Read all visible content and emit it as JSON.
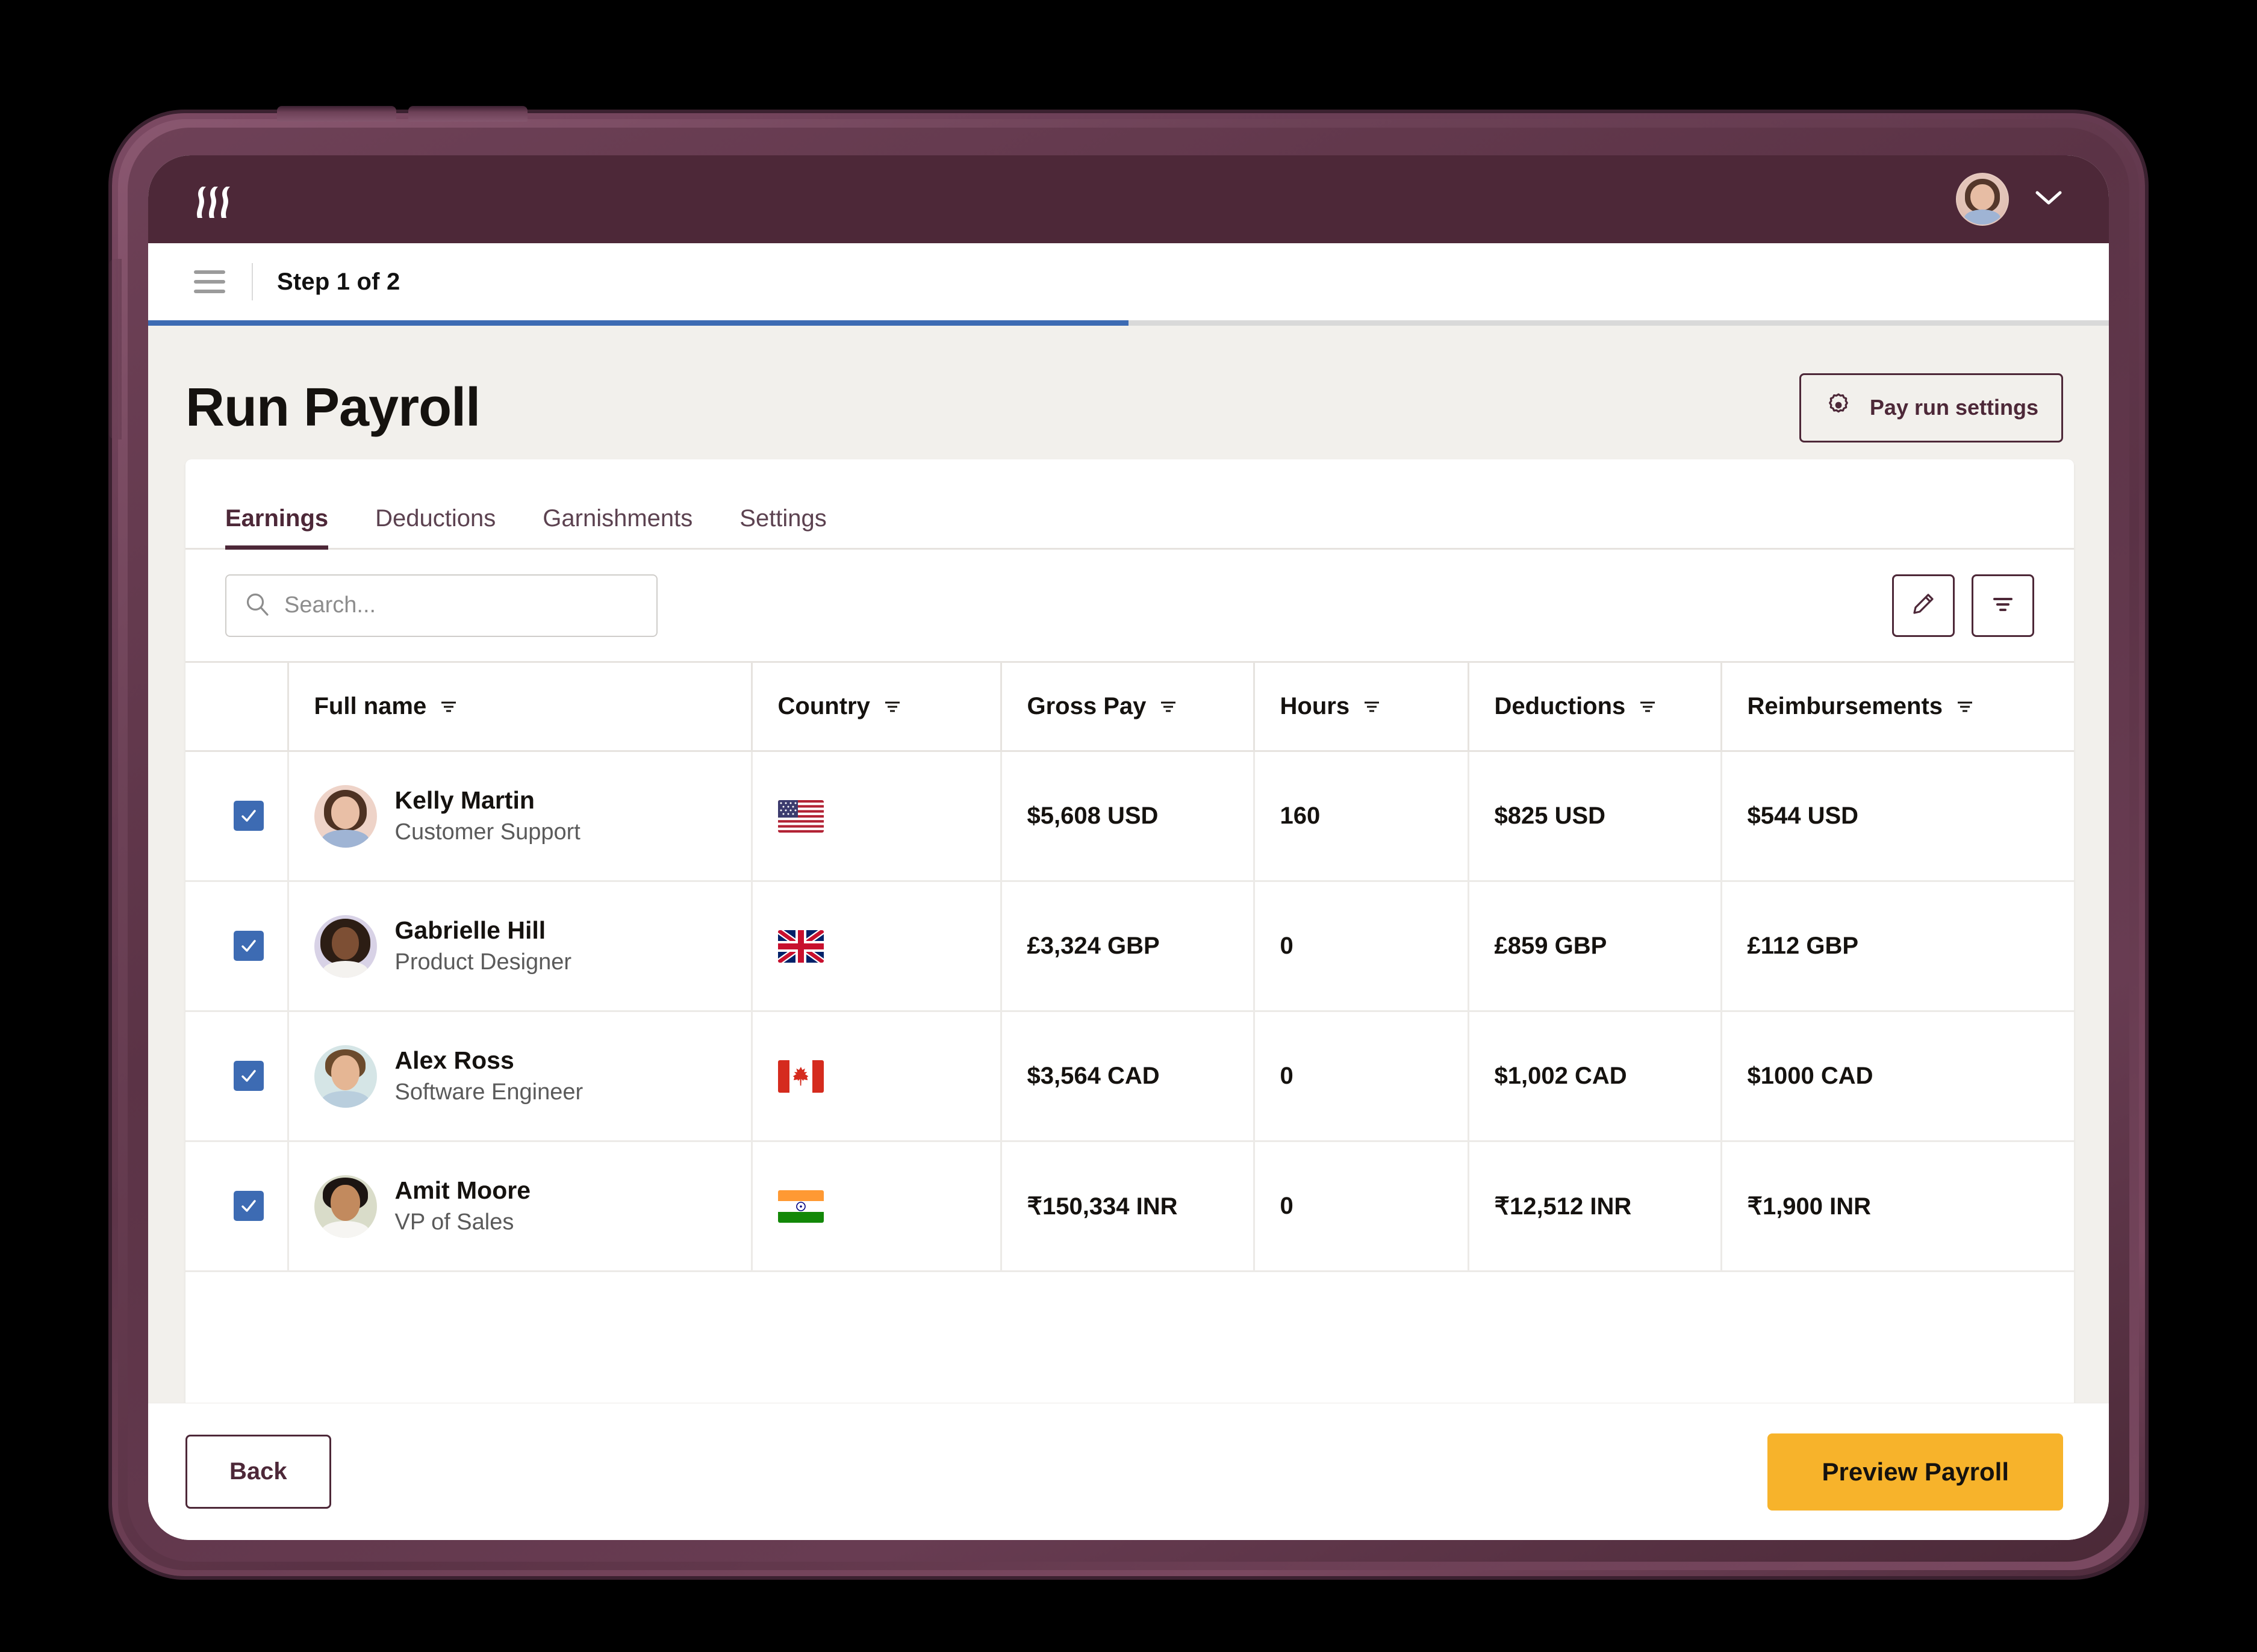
{
  "appbar": {
    "logo_name": "remote-logo",
    "avatar_name": "user-avatar",
    "chevron": "chevron-down-icon"
  },
  "stepbar": {
    "menu_icon": "hamburger-menu-icon",
    "step_label": "Step 1 of 2",
    "progress_percent": 50
  },
  "header": {
    "title": "Run Payroll",
    "settings_button": "Pay run settings",
    "settings_icon": "gear-icon"
  },
  "tabs": [
    {
      "label": "Earnings",
      "active": true
    },
    {
      "label": "Deductions",
      "active": false
    },
    {
      "label": "Garnishments",
      "active": false
    },
    {
      "label": "Settings",
      "active": false
    }
  ],
  "toolbar": {
    "search_placeholder": "Search...",
    "search_value": "",
    "search_icon": "search-icon",
    "edit_icon": "pencil-icon",
    "filter_icon": "filter-icon"
  },
  "table": {
    "columns": [
      {
        "key": "name",
        "label": "Full name",
        "sort_icon": "sort-icon"
      },
      {
        "key": "country",
        "label": "Country",
        "sort_icon": "sort-icon"
      },
      {
        "key": "gross",
        "label": "Gross Pay",
        "sort_icon": "sort-icon"
      },
      {
        "key": "hours",
        "label": "Hours",
        "sort_icon": "sort-icon"
      },
      {
        "key": "deductions",
        "label": "Deductions",
        "sort_icon": "sort-icon"
      },
      {
        "key": "reimbursements",
        "label": "Reimbursements",
        "sort_icon": "sort-icon"
      }
    ],
    "rows": [
      {
        "selected": true,
        "name": "Kelly Martin",
        "role": "Customer Support",
        "country": "United States",
        "flag": "us-flag",
        "gross": "$5,608 USD",
        "hours": "160",
        "deductions": "$825 USD",
        "reimbursements": "$544 USD"
      },
      {
        "selected": true,
        "name": "Gabrielle Hill",
        "role": "Product Designer",
        "country": "United Kingdom",
        "flag": "uk-flag",
        "gross": "£3,324 GBP",
        "hours": "0",
        "deductions": "£859 GBP",
        "reimbursements": "£112 GBP"
      },
      {
        "selected": true,
        "name": "Alex Ross",
        "role": "Software Engineer",
        "country": "Canada",
        "flag": "ca-flag",
        "gross": "$3,564 CAD",
        "hours": "0",
        "deductions": "$1,002 CAD",
        "reimbursements": "$1000 CAD"
      },
      {
        "selected": true,
        "name": "Amit Moore",
        "role": "VP of Sales",
        "country": "India",
        "flag": "in-flag",
        "gross": "₹150,334 INR",
        "hours": "0",
        "deductions": "₹12,512 INR",
        "reimbursements": "₹1,900 INR"
      }
    ]
  },
  "footer": {
    "back_label": "Back",
    "preview_label": "Preview Payroll"
  },
  "colors": {
    "brand_maroon": "#4d2838",
    "accent_yellow": "#f7b32b",
    "progress_blue": "#3d6bb3",
    "checkbox_blue": "#3d6bb3",
    "page_bg": "#f2f0ec"
  }
}
